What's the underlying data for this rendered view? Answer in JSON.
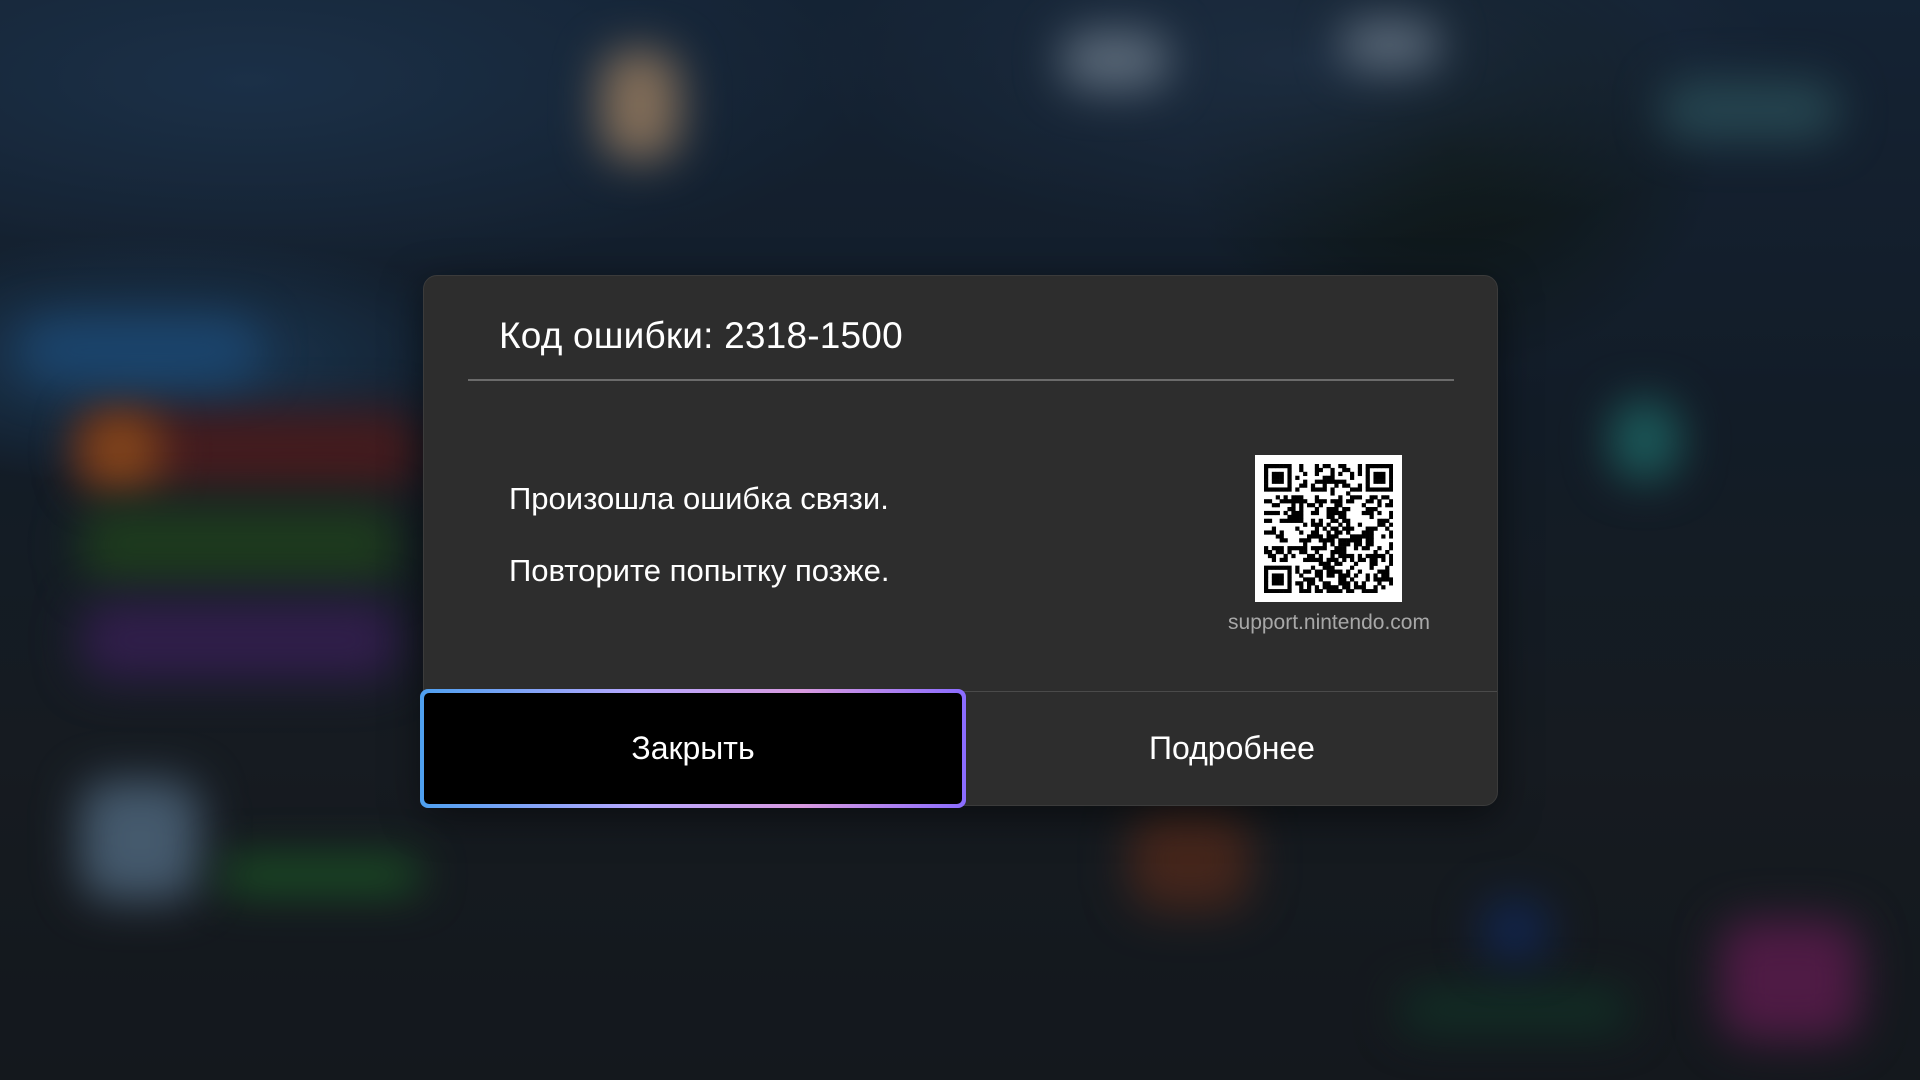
{
  "dialog": {
    "title": "Код ошибки: 2318-1500",
    "message_line1": "Произошла ошибка связи.",
    "message_line2": "Повторите попытку позже.",
    "qr_caption": "support.nintendo.com"
  },
  "buttons": {
    "close_label": "Закрыть",
    "more_label": "Подробнее"
  },
  "colors": {
    "dialog_bg": "#2d2d2d",
    "focus_gradient": [
      "#4ea0f0",
      "#b7a8ff",
      "#d89adf",
      "#8a6cff"
    ],
    "text": "#ffffff",
    "caption": "#a8a8a8"
  },
  "icons": {
    "qr": "qr-code-icon"
  }
}
